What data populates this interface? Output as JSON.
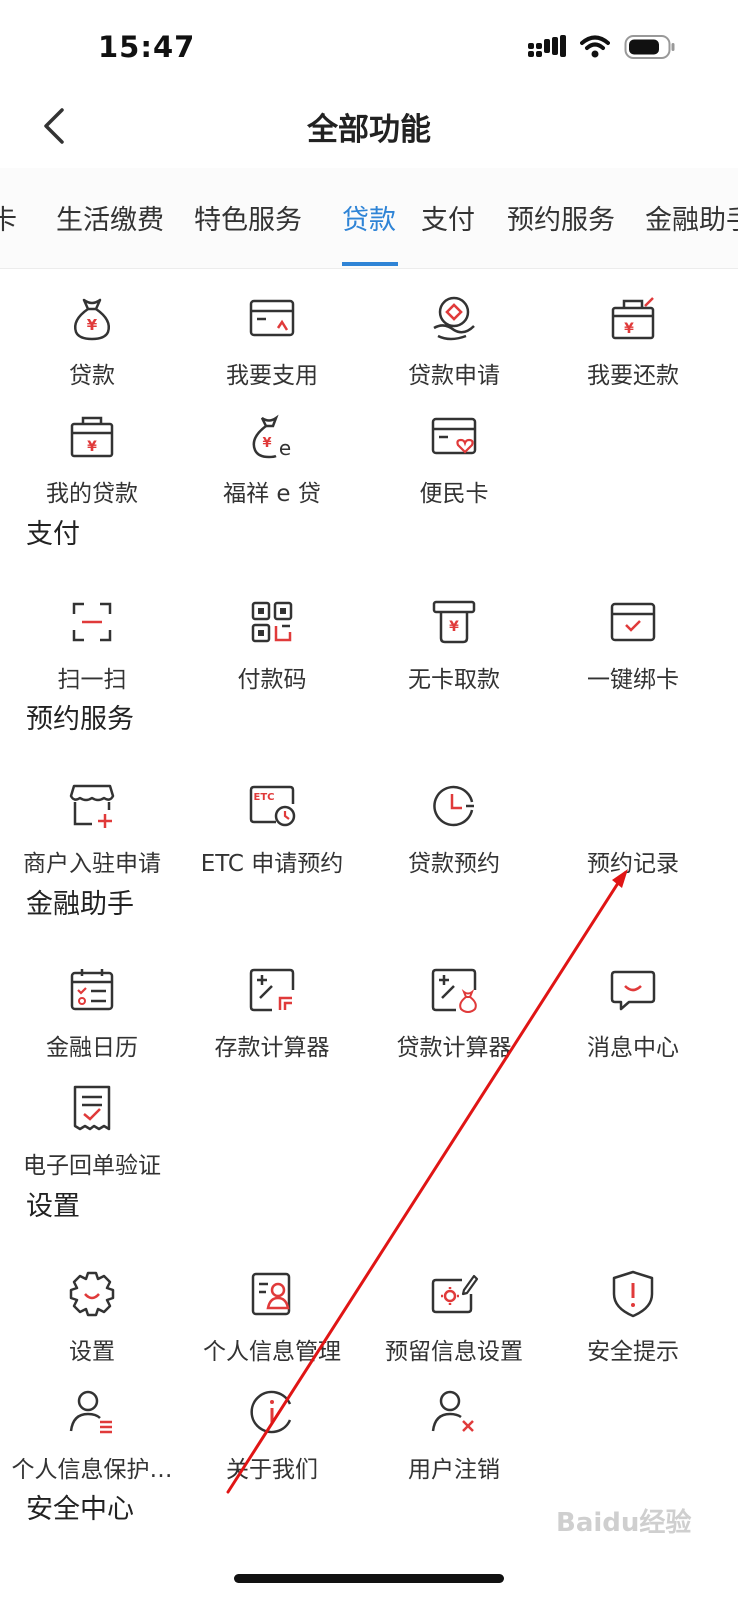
{
  "status_bar": {
    "time": "15:47"
  },
  "header": {
    "title": "全部功能"
  },
  "tabs": [
    {
      "label": "卡"
    },
    {
      "label": "生活缴费"
    },
    {
      "label": "特色服务"
    },
    {
      "label": "贷款",
      "active": true
    },
    {
      "label": "支付"
    },
    {
      "label": "预约服务"
    },
    {
      "label": "金融助手"
    }
  ],
  "sections": {
    "loan": {
      "items": [
        {
          "label": "贷款",
          "icon": "money-bag-icon"
        },
        {
          "label": "我要支用",
          "icon": "card-withdraw-icon"
        },
        {
          "label": "贷款申请",
          "icon": "hand-coin-icon"
        },
        {
          "label": "我要还款",
          "icon": "repay-box-icon"
        },
        {
          "label": "我的贷款",
          "icon": "my-loan-box-icon"
        },
        {
          "label": "福祥 e 贷",
          "icon": "money-bag-e-icon"
        },
        {
          "label": "便民卡",
          "icon": "heart-card-icon"
        }
      ]
    },
    "payment": {
      "title": "支付",
      "items": [
        {
          "label": "扫一扫",
          "icon": "scan-icon"
        },
        {
          "label": "付款码",
          "icon": "qr-code-icon"
        },
        {
          "label": "无卡取款",
          "icon": "atm-cash-icon"
        },
        {
          "label": "一键绑卡",
          "icon": "bind-card-icon"
        }
      ]
    },
    "reservation": {
      "title": "预约服务",
      "items": [
        {
          "label": "商户入驻申请",
          "icon": "store-add-icon"
        },
        {
          "label": "ETC 申请预约",
          "icon": "etc-card-icon"
        },
        {
          "label": "贷款预约",
          "icon": "clock-icon"
        },
        {
          "label": "预约记录",
          "icon": ""
        }
      ]
    },
    "assistant": {
      "title": "金融助手",
      "items": [
        {
          "label": "金融日历",
          "icon": "calendar-icon"
        },
        {
          "label": "存款计算器",
          "icon": "deposit-calculator-icon"
        },
        {
          "label": "贷款计算器",
          "icon": "loan-calculator-icon"
        },
        {
          "label": "消息中心",
          "icon": "message-icon"
        },
        {
          "label": "电子回单验证",
          "icon": "receipt-check-icon"
        }
      ]
    },
    "settings": {
      "title": "设置",
      "items": [
        {
          "label": "设置",
          "icon": "gear-icon"
        },
        {
          "label": "个人信息管理",
          "icon": "profile-card-icon"
        },
        {
          "label": "预留信息设置",
          "icon": "reserved-info-icon"
        },
        {
          "label": "安全提示",
          "icon": "shield-alert-icon"
        },
        {
          "label": "个人信息保护…",
          "icon": "user-list-icon"
        },
        {
          "label": "关于我们",
          "icon": "info-icon"
        },
        {
          "label": "用户注销",
          "icon": "user-remove-icon"
        }
      ]
    },
    "security": {
      "title": "安全中心"
    }
  },
  "watermark": {
    "text": "Baidu经验"
  },
  "colors": {
    "accent_blue": "#2f84d6",
    "icon_dark": "#333333",
    "icon_red": "#e03a3a",
    "annotation_red": "#e01515"
  }
}
